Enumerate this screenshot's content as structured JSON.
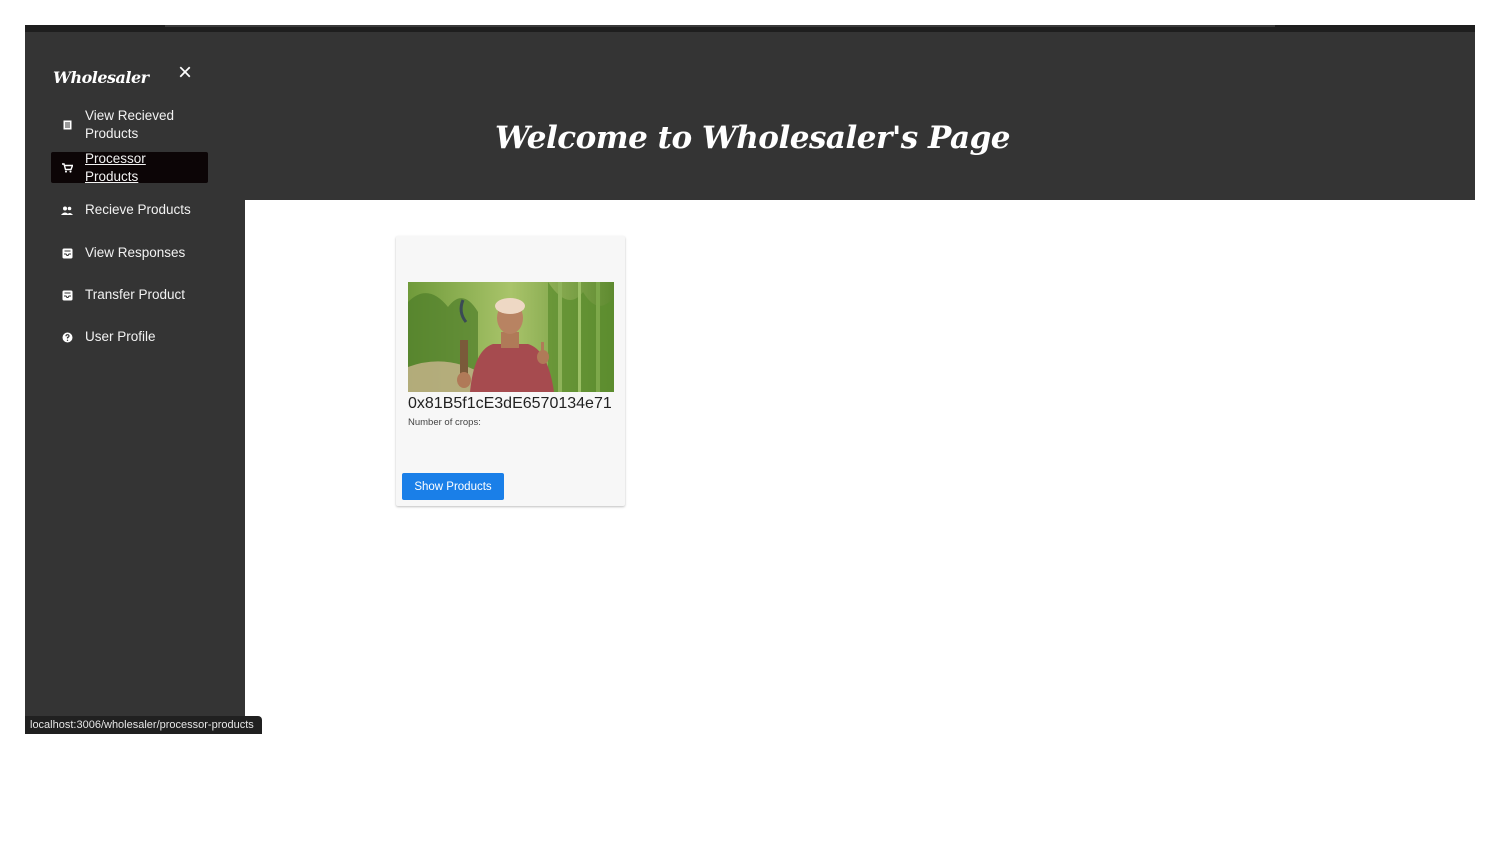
{
  "sidebar": {
    "brand": "Wholesaler",
    "close_glyph": "×",
    "items": [
      {
        "label_line1": "View Recieved",
        "label_line2": "Products",
        "icon": "receipt-icon",
        "active": false
      },
      {
        "label_line1": "Processor",
        "label_line2": "Products",
        "icon": "cart-icon",
        "active": true
      },
      {
        "label": "Recieve Products",
        "icon": "people-icon",
        "active": false
      },
      {
        "label": "View Responses",
        "icon": "inbox-icon",
        "active": false
      },
      {
        "label": "Transfer Product",
        "icon": "inbox-icon",
        "active": false
      },
      {
        "label": "User Profile",
        "icon": "help-circle-icon",
        "active": false
      }
    ]
  },
  "header": {
    "title": "Welcome to Wholesaler's Page"
  },
  "card": {
    "address": "0x81B5f1cE3dE6570134e71",
    "crops_label": "Number of crops:",
    "button_label": "Show Products"
  },
  "status_bar": {
    "url": "localhost:3006/wholesaler/processor-products"
  },
  "colors": {
    "dark": "#343434",
    "active": "#0c0506",
    "button": "#1a7fe8"
  }
}
